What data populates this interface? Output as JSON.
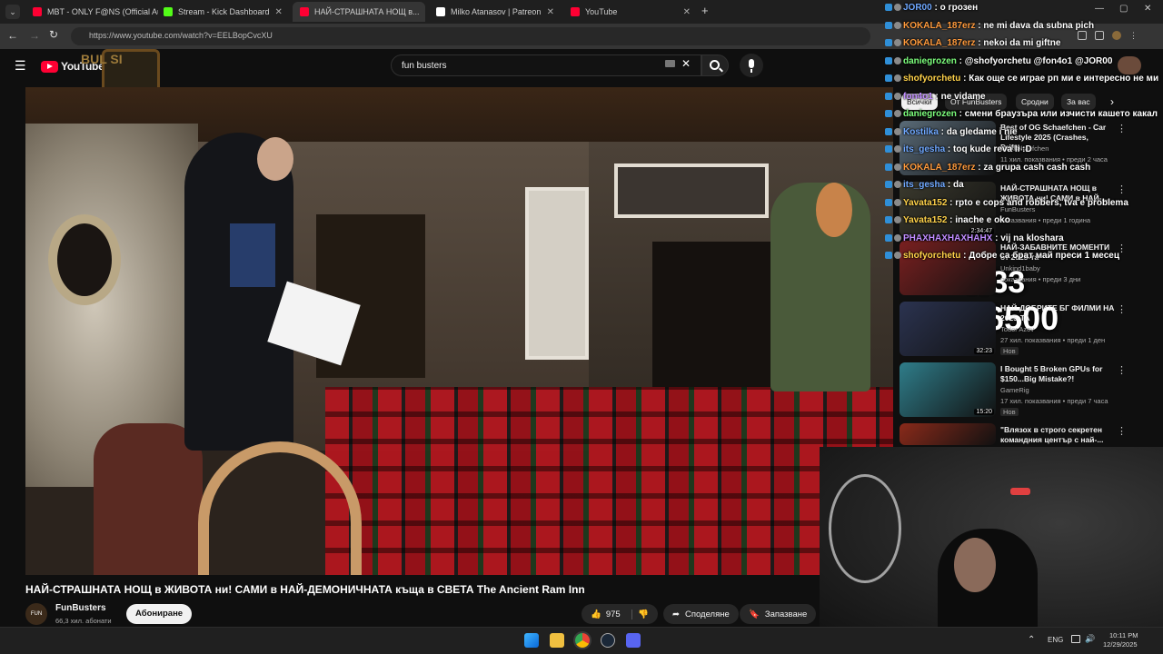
{
  "browser": {
    "tabs": [
      {
        "label": "MBT - ONLY F@NS (Official Au...",
        "active": false,
        "favicon_color": "#ff0033"
      },
      {
        "label": "Stream - Kick Dashboard",
        "active": false,
        "favicon_color": "#53fc18"
      },
      {
        "label": "НАЙ-СТРАШНАТА НОЩ в...",
        "active": true,
        "favicon_color": "#ff0033"
      },
      {
        "label": "Milko Atanasov | Patreon",
        "active": false,
        "favicon_color": "#ffffff"
      },
      {
        "label": "YouTube",
        "active": false,
        "favicon_color": "#ff0033"
      }
    ],
    "url": "https://www.youtube.com/watch?v=EELBopCvcXU"
  },
  "youtube": {
    "logo_text": "YouTube",
    "search_query": "fun busters",
    "video_title": "НАЙ-СТРАШНАТА НОЩ в ЖИВОТА ни! САМИ в НАЙ-ДЕМОНИЧНАТА къща в СВЕТА The Ancient Ram Inn",
    "channel_name": "FunBusters",
    "subscribers": "66,3 хил. абонати",
    "subscribe_label": "Абониране",
    "likes": "975",
    "share_label": "Споделяне",
    "save_label": "Запазване",
    "chips": [
      "Всички",
      "От FunBusters",
      "Сродни",
      "За вас"
    ],
    "recommendations": [
      {
        "title": "Best of OG Schaefchen - Car Lifestyle 2025 (Crashes, Drifts...",
        "channel": "OG Schaefchen",
        "meta": "11 хил. показвания • преди 2 часа",
        "duration": "",
        "thumb": "#5a6b78"
      },
      {
        "title": "НАЙ-СТРАШНАТА НОЩ в ЖИВОТА ни! САМИ в НАЙ-...",
        "channel": "FunBusters",
        "meta": "показвания • преди 1 година",
        "duration": "2:34:47",
        "thumb": "#3b3a2e"
      },
      {
        "title": "НАЙ-ЗАБАВНИТЕ МОМЕНТИ от 2025-та",
        "channel": "Unkind1baby",
        "meta": "показвания • преди 3 дни",
        "duration": "",
        "thumb": "#7a2020"
      },
      {
        "title": "НАЙ-ДОБРИТЕ БГ ФИЛМИ НА 2025-ТА",
        "channel": "Todor Azov",
        "meta": "27 хил. показвания • преди 1 ден",
        "duration": "32:23",
        "badge": "Нов",
        "thumb": "#2b3350"
      },
      {
        "title": "I Bought 5 Broken GPUs for $150...Big Mistake?!",
        "channel": "GameRig",
        "meta": "17 хил. показвания • преди 7 часа",
        "duration": "15:20",
        "badge": "Нов",
        "thumb": "#2f7d8a"
      },
      {
        "title": "\"Влязох в строго секретен командния център с най-...",
        "channel": "",
        "meta": "",
        "duration": "",
        "thumb": "#8a2a1a"
      }
    ]
  },
  "chat": [
    {
      "user": "JOR00",
      "text": " : о грозен",
      "color": "#6fa8ff"
    },
    {
      "user": "KOKALA_187erz",
      "text": " : ne mi dava da subna pich",
      "color": "#ff9a3c"
    },
    {
      "user": "KOKALA_187erz",
      "text": " : nekoi da mi giftne",
      "color": "#ff9a3c"
    },
    {
      "user": "daniegrozen",
      "text": " : @shofyorchetu @fon4o1 @JOR00",
      "color": "#7dff7d"
    },
    {
      "user": "shofyorchetu",
      "text": " : Как още се играе рп ми е интересно не ми",
      "color": "#ffd24a"
    },
    {
      "user": "fon4o1",
      "text": " : ne vidame",
      "color": "#c08cff"
    },
    {
      "user": "daniegrozen",
      "text": " : смени браузъра или изчисти кашето какал",
      "color": "#7dff7d"
    },
    {
      "user": "Kostilka",
      "text": " : da gledame i nie",
      "color": "#6fa8ff"
    },
    {
      "user": "its_gesha",
      "text": " : toq kude reva li :D",
      "color": "#6fa8ff"
    },
    {
      "user": "KOKALA_187erz",
      "text": " : za grupa cash cash cash",
      "color": "#ff9a3c"
    },
    {
      "user": "its_gesha",
      "text": " : da",
      "color": "#6fa8ff"
    },
    {
      "user": "Yavata152",
      "text": " : rpto e cops and robbers, tva e problema",
      "color": "#ffd24a"
    },
    {
      "user": "Yavata152",
      "text": " : inache e oko",
      "color": "#ffd24a"
    },
    {
      "user": "PHAXHAXHAXHAHX",
      "text": " : vij na kloshara",
      "color": "#c08cff"
    },
    {
      "user": "shofyorchetu",
      "text": " : Добре са брат май преси 1 месец",
      "color": "#ffd24a"
    }
  ],
  "overlay": {
    "counter_top": "7/33",
    "counter_main": "0/16500",
    "brand_text": "BUL SI"
  },
  "taskbar": {
    "lang": "ENG",
    "time": "10:11 PM",
    "date": "12/29/2025"
  }
}
